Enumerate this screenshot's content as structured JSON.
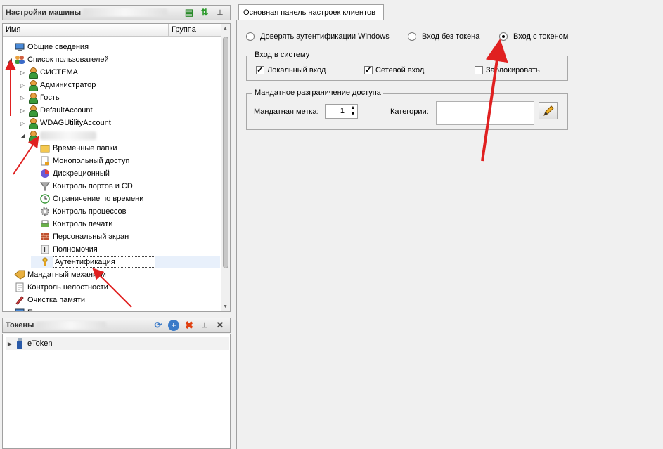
{
  "left": {
    "title": "Настройки машины",
    "columns": {
      "name": "Имя",
      "group": "Группа"
    },
    "tree": [
      {
        "label": "Общие сведения",
        "icon": "monitor-icon",
        "level": 0
      },
      {
        "label": "Список пользователей",
        "icon": "users-icon",
        "level": 0,
        "expanded": true
      },
      {
        "label": "СИСТЕМА",
        "icon": "user-icon",
        "level": 1
      },
      {
        "label": "Администратор",
        "icon": "user-icon",
        "level": 1
      },
      {
        "label": "Гость",
        "icon": "user-icon",
        "level": 1
      },
      {
        "label": "DefaultAccount",
        "icon": "user-icon",
        "level": 1
      },
      {
        "label": "WDAGUtilityAccount",
        "icon": "user-icon",
        "level": 1
      },
      {
        "label": "",
        "icon": "user-icon",
        "level": 1,
        "expanded": true
      },
      {
        "label": "Временные папки",
        "icon": "folder-icon",
        "level": 2
      },
      {
        "label": "Монопольный доступ",
        "icon": "document-lock-icon",
        "level": 2
      },
      {
        "label": "Дискреционный",
        "icon": "pie-icon",
        "level": 2
      },
      {
        "label": "Контроль портов и CD",
        "icon": "funnel-icon",
        "level": 2
      },
      {
        "label": "Ограничение по времени",
        "icon": "clock-icon",
        "level": 2
      },
      {
        "label": "Контроль процессов",
        "icon": "gear-icon",
        "level": 2
      },
      {
        "label": "Контроль печати",
        "icon": "printer-icon",
        "level": 2
      },
      {
        "label": "Персональный экран",
        "icon": "firewall-icon",
        "level": 2
      },
      {
        "label": "Полномочия",
        "icon": "info-icon",
        "level": 2
      },
      {
        "label": "Аутентификация",
        "icon": "key-icon",
        "level": 2,
        "selected": true
      },
      {
        "label": "Мандатный механизм",
        "icon": "tag-icon",
        "level": 0
      },
      {
        "label": "Контроль целостности",
        "icon": "document-icon",
        "level": 0
      },
      {
        "label": "Очистка памяти",
        "icon": "eraser-icon",
        "level": 0
      },
      {
        "label": "Параметры",
        "icon": "monitor-icon",
        "level": 0
      }
    ]
  },
  "tokens": {
    "title": "Токены",
    "items": [
      {
        "label": "eToken",
        "icon": "usb-token-icon"
      }
    ]
  },
  "right": {
    "tab": "Основная панель настроек клиентов",
    "auth_options": [
      {
        "label": "Доверять аутентификации Windows",
        "checked": false
      },
      {
        "label": "Вход без токена",
        "checked": false
      },
      {
        "label": "Вход с токеном",
        "checked": true
      }
    ],
    "login_group": {
      "title": "Вход в систему",
      "local": {
        "label": "Локальный вход",
        "checked": true
      },
      "network": {
        "label": "Сетевой вход",
        "checked": true
      },
      "block": {
        "label": "Заблокировать",
        "checked": false
      }
    },
    "mandatory_group": {
      "title": "Мандатное разграничение доступа",
      "label_caption": "Мандатная метка:",
      "label_value": "1",
      "categories_caption": "Категории:",
      "categories_value": ""
    }
  },
  "colors": {
    "annotation_arrow": "#e02020",
    "selection": "#e8f0fb"
  }
}
